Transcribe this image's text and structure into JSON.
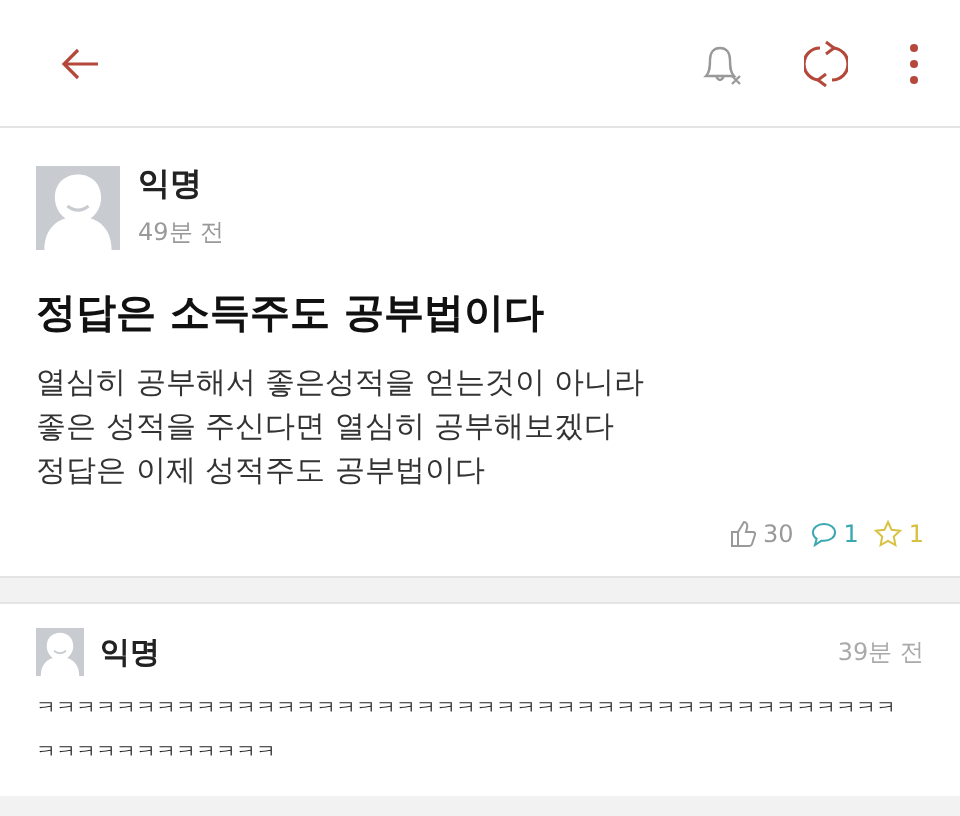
{
  "post": {
    "author": "익명",
    "time": "49분 전",
    "title": "정답은 소득주도 공부법이다",
    "body": [
      "열심히 공부해서 좋은성적을 얻는것이 아니라",
      "좋은 성적을 주신다면 열심히 공부해보겠다",
      "정답은 이제 성적주도 공부법이다"
    ],
    "stats": [
      {
        "kind": "like",
        "count": "30",
        "color": "#999999"
      },
      {
        "kind": "comment",
        "count": "1",
        "color": "#3aa8b0"
      },
      {
        "kind": "scrap",
        "count": "1",
        "color": "#d8c040"
      }
    ]
  },
  "comments": [
    {
      "author": "익명",
      "time": "39분 전",
      "text": "ㅋㅋㅋㅋㅋㅋㅋㅋㅋㅋㅋㅋㅋㅋㅋㅋㅋㅋㅋㅋㅋㅋㅋㅋㅋㅋㅋㅋㅋㅋㅋㅋㅋㅋㅋㅋㅋㅋㅋㅋㅋㅋㅋㅋㅋㅋㅋㅋㅋㅋㅋㅋㅋㅋㅋ"
    }
  ]
}
